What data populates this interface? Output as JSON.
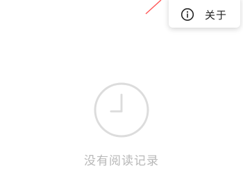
{
  "menu": {
    "about_label": "关于",
    "icon": "info-icon"
  },
  "empty_state": {
    "icon": "clock-icon",
    "message": "没有阅读记录"
  },
  "colors": {
    "accent_line": "#ff5a5a",
    "empty_gray": "#dcdcdc",
    "empty_text": "#b8b8b8"
  }
}
